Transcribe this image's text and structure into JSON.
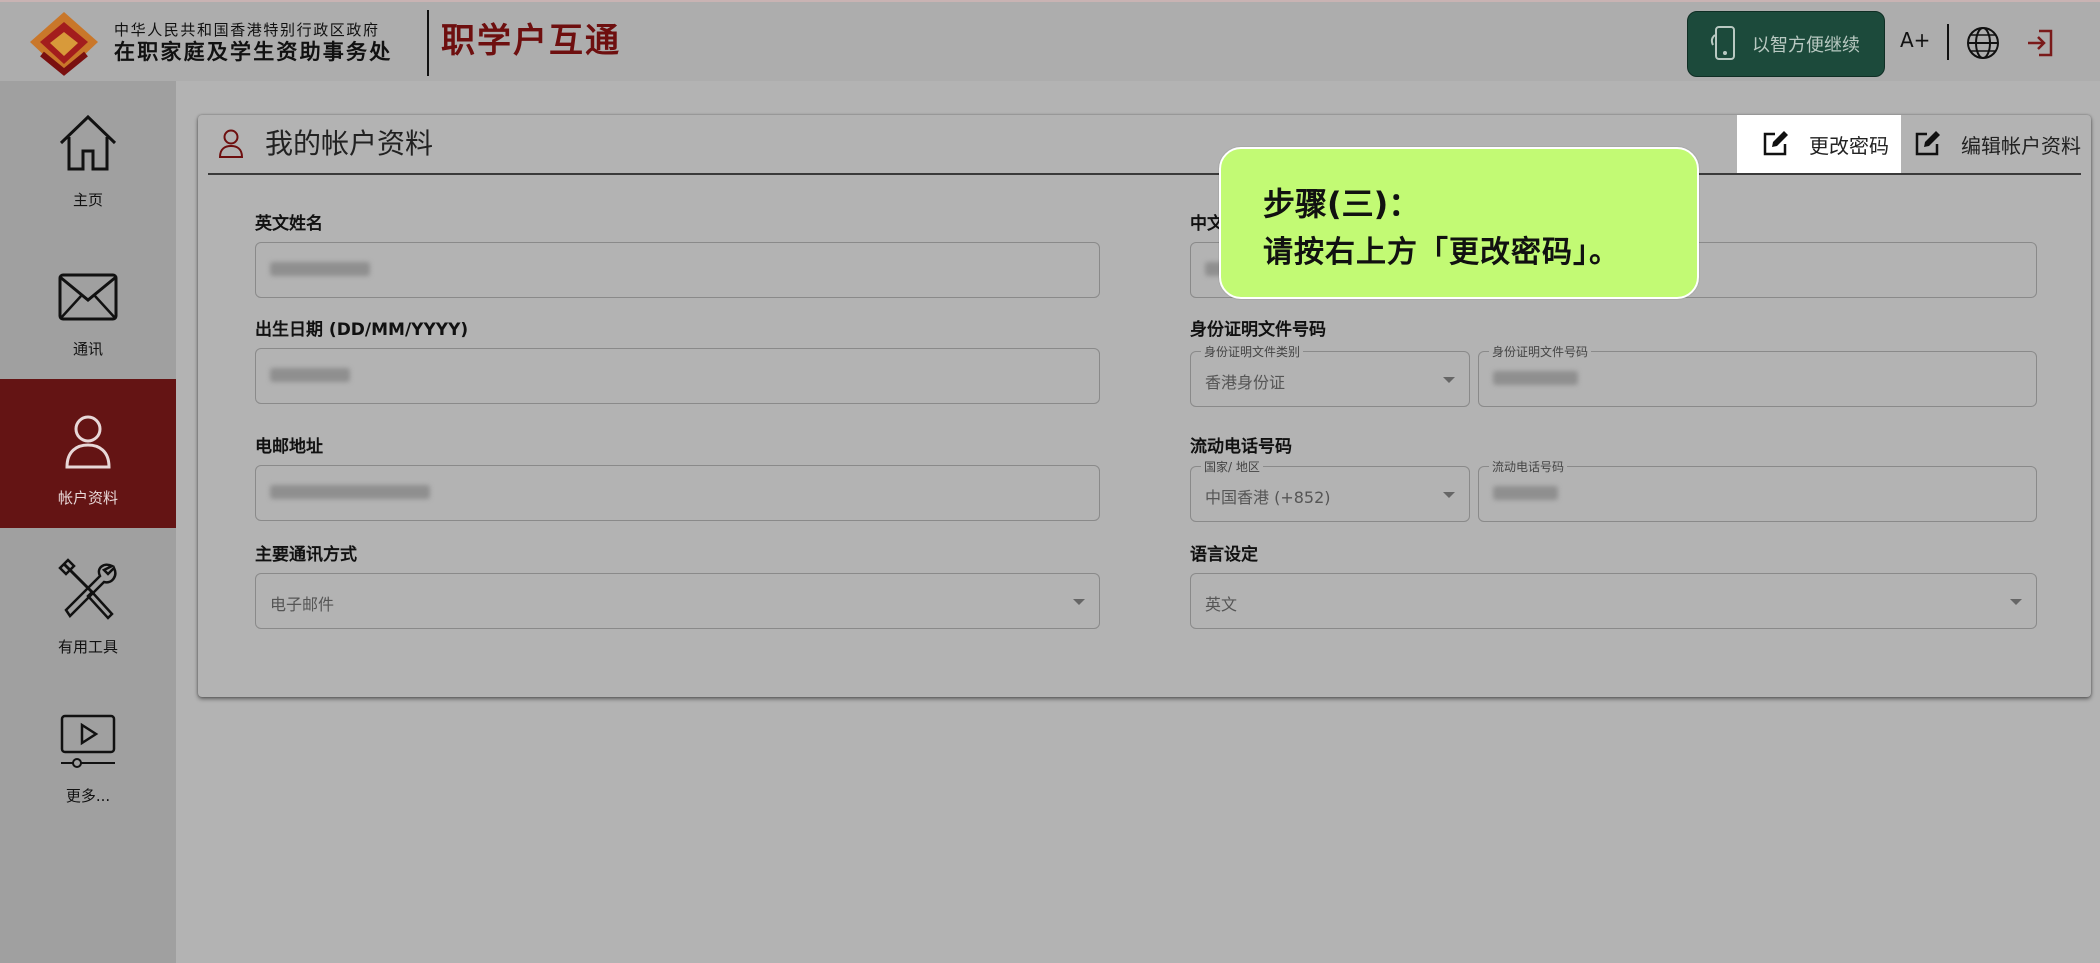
{
  "header": {
    "org_line1": "中华人民共和国香港特别行政区政府",
    "org_line2": "在职家庭及学生资助事务处",
    "app_title": "职学户互通",
    "continue_on_mobile": "以智方便继续",
    "font_size_button": "A+"
  },
  "sidebar": {
    "items": [
      {
        "label": "主页",
        "icon": "home-icon"
      },
      {
        "label": "通讯",
        "icon": "mail-icon"
      },
      {
        "label": "帐户资料",
        "icon": "user-icon",
        "active": true
      },
      {
        "label": "有用工具",
        "icon": "tools-icon"
      },
      {
        "label": "更多...",
        "icon": "video-icon"
      }
    ]
  },
  "card": {
    "title": "我的帐户资料",
    "change_password": "更改密码",
    "edit_profile": "编辑帐户资料"
  },
  "form": {
    "english_name_label": "英文姓名",
    "chinese_name_label": "中文",
    "dob_label": "出生日期 (DD/MM/YYYY)",
    "id_doc_label": "身份证明文件号码",
    "id_doc_type_sublabel": "身份证明文件类别",
    "id_doc_type_value": "香港身份证",
    "id_doc_number_sublabel": "身份证明文件号码",
    "email_label": "电邮地址",
    "mobile_label": "流动电话号码",
    "country_sublabel": "国家/ 地区",
    "country_value": "中国香港 (+852)",
    "mobile_sublabel": "流动电话号码",
    "comm_method_label": "主要通讯方式",
    "comm_method_value": "电子邮件",
    "language_label": "语言设定",
    "language_value": "英文"
  },
  "callout": {
    "line1": "步骤(三)：",
    "line2": "请按右上方「更改密码」。"
  },
  "colors": {
    "brand_red": "#6e0f0f",
    "active_nav": "#641414",
    "continue_btn": "#1c4a3b",
    "callout_bg": "#c2fa74"
  }
}
